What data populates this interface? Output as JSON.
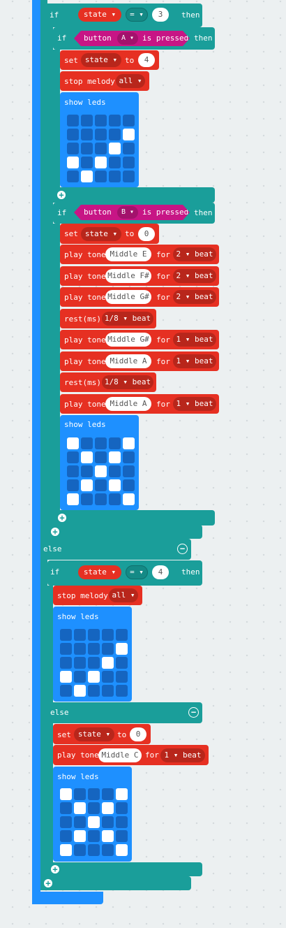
{
  "blocks": {
    "if1": {
      "kw": "if",
      "var": "state ▾",
      "op": "= ▾",
      "value": "3",
      "then": "then"
    },
    "ifA": {
      "kw": "if",
      "button": "button",
      "btn_letter": "A ▾",
      "pressed": "is pressed",
      "then": "then"
    },
    "setA": {
      "kw": "set",
      "var": "state ▾",
      "to": "to",
      "value": "4"
    },
    "stopA": {
      "label": "stop melody",
      "value": "all ▾"
    },
    "showA": {
      "label": "show leds",
      "leds": [
        0,
        0,
        0,
        0,
        0,
        0,
        0,
        0,
        0,
        1,
        0,
        0,
        0,
        1,
        0,
        1,
        0,
        1,
        0,
        0,
        0,
        1,
        0,
        0,
        0
      ]
    },
    "ifB": {
      "kw": "if",
      "button": "button",
      "btn_letter": "B ▾",
      "pressed": "is pressed",
      "then": "then"
    },
    "setB": {
      "kw": "set",
      "var": "state ▾",
      "to": "to",
      "value": "0"
    },
    "tones": [
      {
        "kind": "tone",
        "label": "play tone",
        "note": "Middle E",
        "for": "for",
        "beat_val": "2 ▾",
        "beat": "beat"
      },
      {
        "kind": "tone",
        "label": "play tone",
        "note": "Middle F#",
        "for": "for",
        "beat_val": "2 ▾",
        "beat": "beat"
      },
      {
        "kind": "tone",
        "label": "play tone",
        "note": "Middle G#",
        "for": "for",
        "beat_val": "2 ▾",
        "beat": "beat"
      },
      {
        "kind": "rest",
        "label": "rest(ms)",
        "beat_val": "1/8 ▾",
        "beat": "beat"
      },
      {
        "kind": "tone",
        "label": "play tone",
        "note": "Middle G#",
        "for": "for",
        "beat_val": "1 ▾",
        "beat": "beat"
      },
      {
        "kind": "tone",
        "label": "play tone",
        "note": "Middle A",
        "for": "for",
        "beat_val": "1 ▾",
        "beat": "beat"
      },
      {
        "kind": "rest",
        "label": "rest(ms)",
        "beat_val": "1/8 ▾",
        "beat": "beat"
      },
      {
        "kind": "tone",
        "label": "play tone",
        "note": "Middle A",
        "for": "for",
        "beat_val": "1 ▾",
        "beat": "beat"
      }
    ],
    "showB": {
      "label": "show leds",
      "leds": [
        1,
        0,
        0,
        0,
        1,
        0,
        1,
        0,
        1,
        0,
        0,
        0,
        1,
        0,
        0,
        0,
        1,
        0,
        1,
        0,
        1,
        0,
        0,
        0,
        1
      ]
    },
    "else1": {
      "label": "else"
    },
    "if4": {
      "kw": "if",
      "var": "state ▾",
      "op": "= ▾",
      "value": "4",
      "then": "then"
    },
    "stop4": {
      "label": "stop melody",
      "value": "all ▾"
    },
    "show4": {
      "label": "show leds",
      "leds": [
        0,
        0,
        0,
        0,
        0,
        0,
        0,
        0,
        0,
        1,
        0,
        0,
        0,
        1,
        0,
        1,
        0,
        1,
        0,
        0,
        0,
        1,
        0,
        0,
        0
      ]
    },
    "else2": {
      "label": "else"
    },
    "set0": {
      "kw": "set",
      "var": "state ▾",
      "to": "to",
      "value": "0"
    },
    "toneC": {
      "label": "play tone",
      "note": "Middle C",
      "for": "for",
      "beat_val": "1 ▾",
      "beat": "beat"
    },
    "showC": {
      "label": "show leds",
      "leds": [
        1,
        0,
        0,
        0,
        1,
        0,
        1,
        0,
        1,
        0,
        0,
        0,
        1,
        0,
        0,
        0,
        1,
        0,
        1,
        0,
        1,
        0,
        0,
        0,
        1
      ]
    }
  },
  "colors": {
    "logic": "#1a9e9a",
    "loops": "#1e90ff",
    "music": "#e63022",
    "variables": "#e63022",
    "input": "#c71585"
  }
}
